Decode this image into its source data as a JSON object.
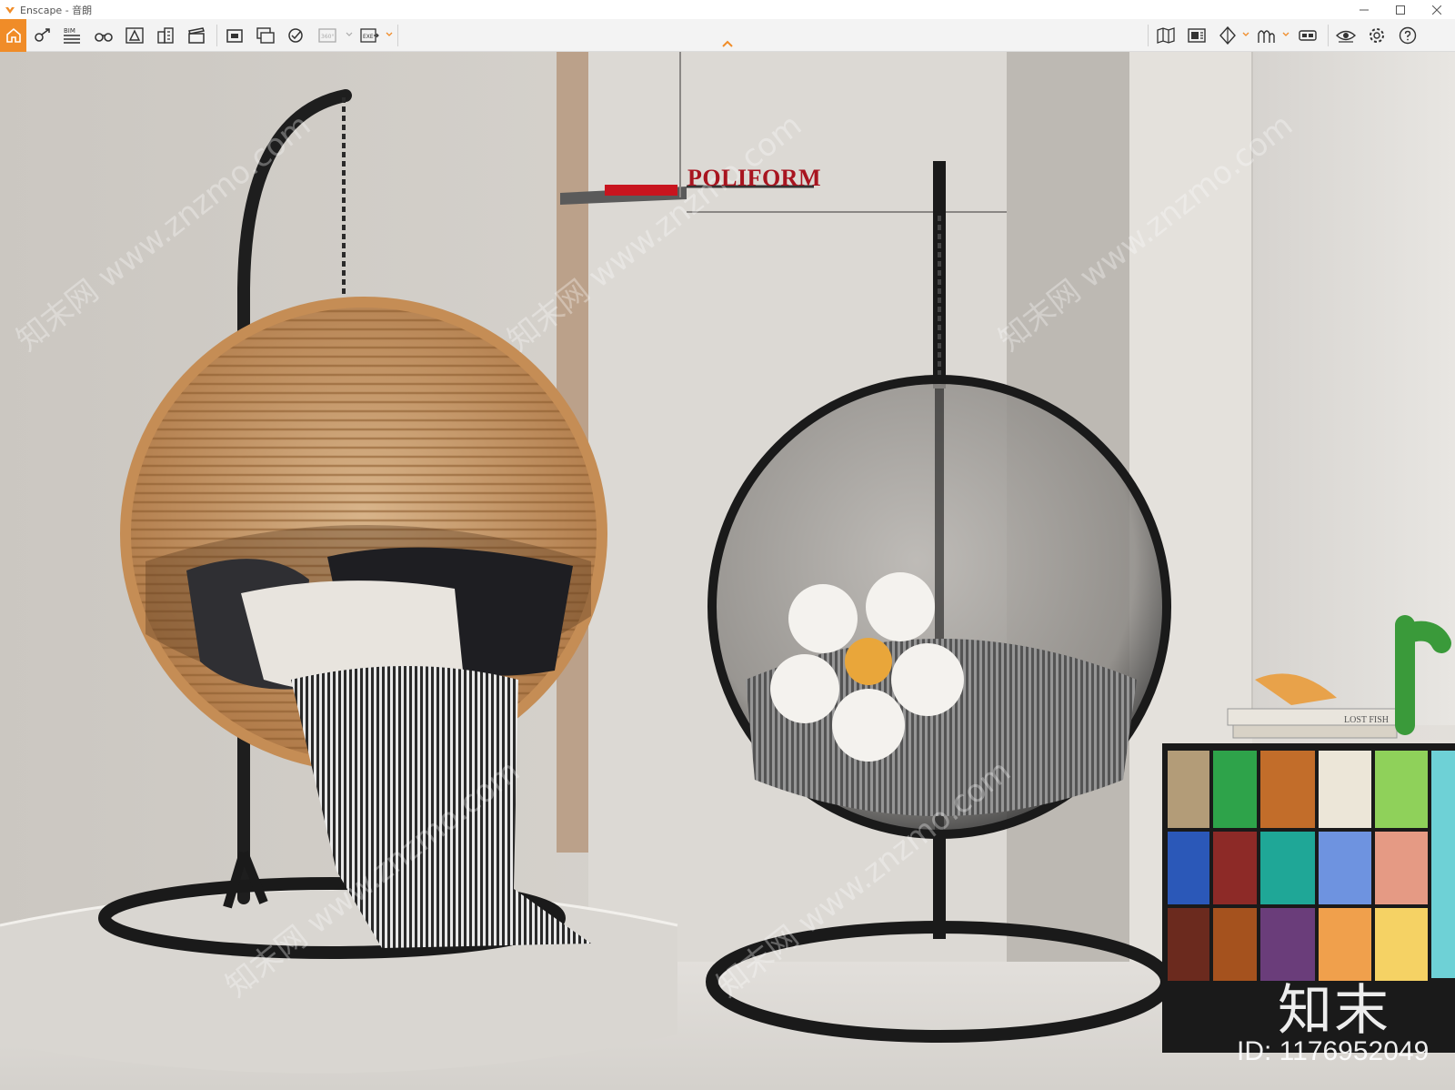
{
  "window": {
    "title": "Enscape - 音朗",
    "controls": [
      "minimize-icon",
      "maximize-icon",
      "close-icon"
    ]
  },
  "toolbar": {
    "accent": "#f08c28",
    "left_icons": [
      "home-icon",
      "views-icon",
      "bim-icon",
      "binoculars-icon",
      "asset-library-icon",
      "buildings-icon",
      "video-editor-icon",
      "screenshot-icon",
      "batch-render-icon",
      "panorama-upload-icon",
      "360-panorama-icon",
      "exe-export-icon"
    ],
    "bim_label": "BIM",
    "pano_label": "360°",
    "exe_label": "EXE",
    "right_icons": [
      "map-icon",
      "settings-panel-icon",
      "visual-settings-icon",
      "people-icon",
      "vr-headset-icon",
      "visibility-icon",
      "gear-icon",
      "help-icon"
    ]
  },
  "viewport": {
    "sign_text": "POLIFORM",
    "book_text": "LOST FISH",
    "watermark_logo": "知末",
    "watermark_id": "ID: 1176952049",
    "watermark_diagonal": "知末网 www.znzmo.com"
  }
}
